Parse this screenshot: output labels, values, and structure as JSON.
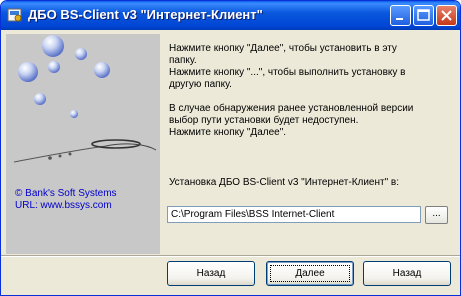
{
  "window": {
    "title": "ДБО BS-Client v3 \"Интернет-Клиент\""
  },
  "titlebar_buttons": [
    {
      "name": "minimize-icon"
    },
    {
      "name": "maximize-icon"
    },
    {
      "name": "close-icon"
    }
  ],
  "banner": {
    "copyright_line1": "© Bank's Soft Systems",
    "copyright_line2": "URL:  www.bssys.com"
  },
  "instructions": {
    "line1": "Нажмите кнопку \"Далее\", чтобы установить в эту",
    "line2": "папку.",
    "line3": "Нажмите кнопку \"...\", чтобы выполнить установку в",
    "line4": "другую папку.",
    "line5": "В случае обнаружения ранее установленной версии",
    "line6": "выбор пути установки будет недоступен.",
    "line7": "Нажмите кнопку \"Далее\"."
  },
  "install": {
    "label": "Установка ДБО BS-Client v3 \"Интернет-Клиент\" в:",
    "path": "C:\\Program Files\\BSS Internet-Client",
    "browse_label": "..."
  },
  "buttons": {
    "back": "Назад",
    "next": "Далее",
    "cancel": "Назад"
  },
  "colors": {
    "titlebar": "#0a58de",
    "window_bg": "#ece9d8",
    "link_text": "#0000cc"
  }
}
